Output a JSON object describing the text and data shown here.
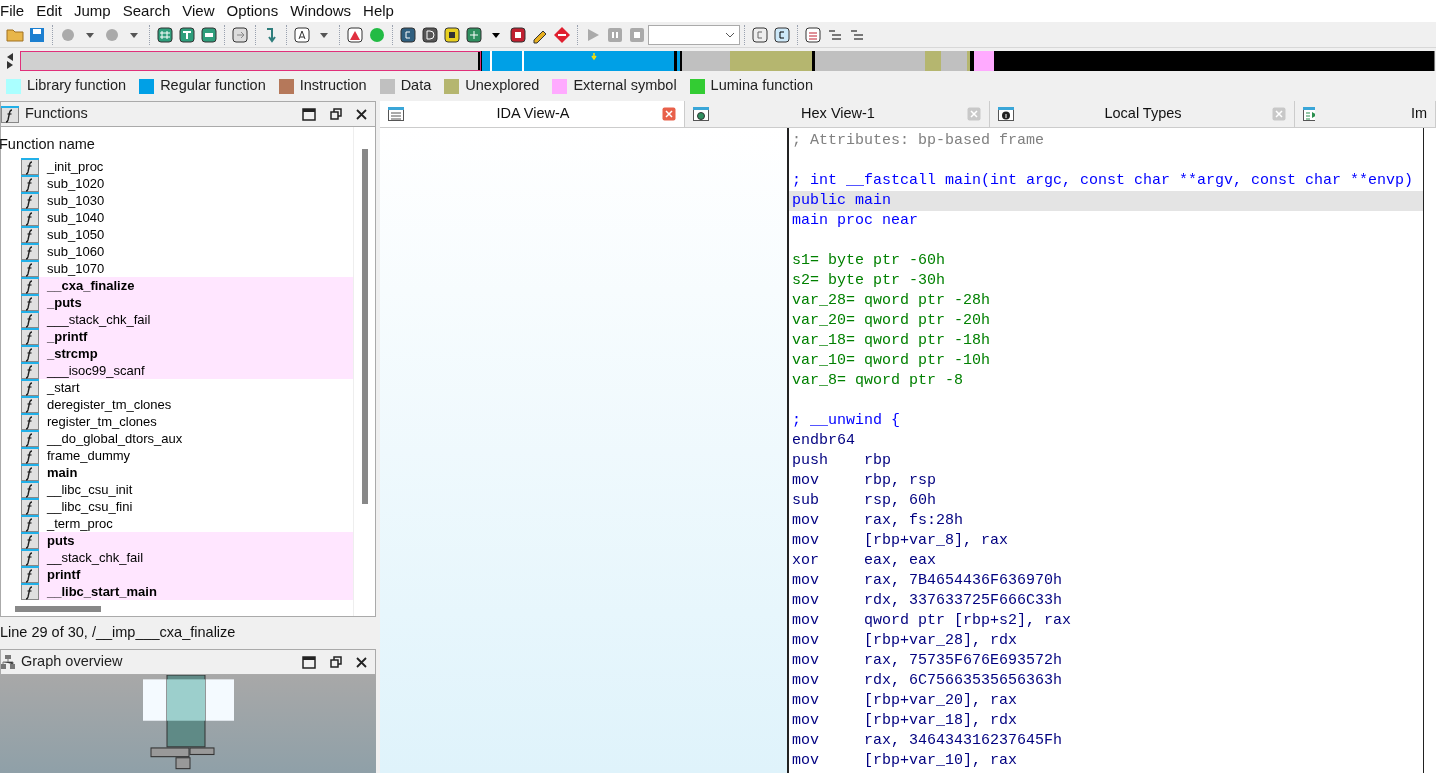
{
  "menu": [
    "File",
    "Edit",
    "Jump",
    "Search",
    "View",
    "Options",
    "Windows",
    "Help"
  ],
  "legend": [
    {
      "label": "Library function",
      "color": "#aaffff"
    },
    {
      "label": "Regular function",
      "color": "#00a0e6"
    },
    {
      "label": "Instruction",
      "color": "#b5785a"
    },
    {
      "label": "Data",
      "color": "#c0c0c0"
    },
    {
      "label": "Unexplored",
      "color": "#b5b66f"
    },
    {
      "label": "External symbol",
      "color": "#ffaaff"
    },
    {
      "label": "Lumina function",
      "color": "#33cc33"
    }
  ],
  "functions_panel": {
    "title": "Functions",
    "column": "Function name",
    "status": "Line 29 of 30, /__imp___cxa_finalize",
    "items": [
      {
        "name": "_init_proc",
        "kind": "regular",
        "bold": false
      },
      {
        "name": "sub_1020",
        "kind": "regular",
        "bold": false
      },
      {
        "name": "sub_1030",
        "kind": "regular",
        "bold": false
      },
      {
        "name": "sub_1040",
        "kind": "regular",
        "bold": false
      },
      {
        "name": "sub_1050",
        "kind": "regular",
        "bold": false
      },
      {
        "name": "sub_1060",
        "kind": "regular",
        "bold": false
      },
      {
        "name": "sub_1070",
        "kind": "regular",
        "bold": false
      },
      {
        "name": "__cxa_finalize",
        "kind": "extern",
        "bold": true
      },
      {
        "name": "_puts",
        "kind": "extern",
        "bold": true
      },
      {
        "name": "___stack_chk_fail",
        "kind": "extern",
        "bold": false
      },
      {
        "name": "_printf",
        "kind": "extern",
        "bold": true
      },
      {
        "name": "_strcmp",
        "kind": "extern",
        "bold": true
      },
      {
        "name": "___isoc99_scanf",
        "kind": "extern",
        "bold": false
      },
      {
        "name": "_start",
        "kind": "regular",
        "bold": false
      },
      {
        "name": "deregister_tm_clones",
        "kind": "regular",
        "bold": false
      },
      {
        "name": "register_tm_clones",
        "kind": "regular",
        "bold": false
      },
      {
        "name": "__do_global_dtors_aux",
        "kind": "regular",
        "bold": false
      },
      {
        "name": "frame_dummy",
        "kind": "regular",
        "bold": false
      },
      {
        "name": "main",
        "kind": "regular",
        "bold": true
      },
      {
        "name": "__libc_csu_init",
        "kind": "regular",
        "bold": false
      },
      {
        "name": "__libc_csu_fini",
        "kind": "regular",
        "bold": false
      },
      {
        "name": "_term_proc",
        "kind": "regular",
        "bold": false
      },
      {
        "name": "puts",
        "kind": "extern",
        "bold": true
      },
      {
        "name": "__stack_chk_fail",
        "kind": "extern",
        "bold": false
      },
      {
        "name": "printf",
        "kind": "extern",
        "bold": true
      },
      {
        "name": "__libc_start_main",
        "kind": "extern",
        "bold": true
      }
    ]
  },
  "graph_overview": {
    "title": "Graph overview"
  },
  "tabs": [
    {
      "label": "IDA View-A",
      "selected": true,
      "kind": "list"
    },
    {
      "label": "Hex View-1",
      "selected": false,
      "kind": "hex"
    },
    {
      "label": "Local Types",
      "selected": false,
      "kind": "info"
    },
    {
      "label": "Im",
      "selected": false,
      "kind": "table"
    }
  ],
  "code": [
    {
      "kind": "comment",
      "text": "; Attributes: bp-based frame",
      "selected": false
    },
    {
      "kind": "blank",
      "selected": false
    },
    {
      "kind": "proto",
      "text": "; int __fastcall main(int argc, const char **argv, const char **envp)",
      "selected": false
    },
    {
      "kind": "label",
      "text": "public main",
      "selected": true
    },
    {
      "kind": "label",
      "text": "main proc near",
      "selected": false
    },
    {
      "kind": "blank",
      "selected": false
    },
    {
      "kind": "var",
      "text": "s1= byte ptr -60h",
      "selected": false
    },
    {
      "kind": "var",
      "text": "s2= byte ptr -30h",
      "selected": false
    },
    {
      "kind": "var",
      "text": "var_28= qword ptr -28h",
      "selected": false
    },
    {
      "kind": "var",
      "text": "var_20= qword ptr -20h",
      "selected": false
    },
    {
      "kind": "var",
      "text": "var_18= qword ptr -18h",
      "selected": false
    },
    {
      "kind": "var",
      "text": "var_10= qword ptr -10h",
      "selected": false
    },
    {
      "kind": "var",
      "text": "var_8= qword ptr -8",
      "selected": false
    },
    {
      "kind": "blank",
      "selected": false
    },
    {
      "kind": "proto",
      "text": "; __unwind {",
      "selected": false
    },
    {
      "kind": "instr",
      "mnemonic": "endbr64",
      "selected": false
    },
    {
      "kind": "instr",
      "mnemonic": "push",
      "operands": "rbp",
      "selected": false
    },
    {
      "kind": "instr",
      "mnemonic": "mov",
      "operands": "rbp, rsp",
      "selected": false
    },
    {
      "kind": "instr",
      "mnemonic": "sub",
      "operands": "rsp, 60h",
      "selected": false
    },
    {
      "kind": "instr",
      "mnemonic": "mov",
      "operands": "rax, fs:28h",
      "selected": false
    },
    {
      "kind": "instr",
      "mnemonic": "mov",
      "operands": "[rbp+var_8], rax",
      "selected": false
    },
    {
      "kind": "instr",
      "mnemonic": "xor",
      "operands": "eax, eax",
      "selected": false
    },
    {
      "kind": "instr",
      "mnemonic": "mov",
      "operands": "rax, 7B4654436F636970h",
      "selected": false
    },
    {
      "kind": "instr",
      "mnemonic": "mov",
      "operands": "rdx, 337633725F666C33h",
      "selected": false
    },
    {
      "kind": "instr",
      "mnemonic": "mov",
      "operands": "qword ptr [rbp+s2], rax",
      "selected": false
    },
    {
      "kind": "instr",
      "mnemonic": "mov",
      "operands": "[rbp+var_28], rdx",
      "selected": false
    },
    {
      "kind": "instr",
      "mnemonic": "mov",
      "operands": "rax, 75735F676E693572h",
      "selected": false
    },
    {
      "kind": "instr",
      "mnemonic": "mov",
      "operands": "rdx, 6C75663535656363h",
      "selected": false
    },
    {
      "kind": "instr",
      "mnemonic": "mov",
      "operands": "[rbp+var_20], rax",
      "selected": false
    },
    {
      "kind": "instr",
      "mnemonic": "mov",
      "operands": "[rbp+var_18], rdx",
      "selected": false
    },
    {
      "kind": "instr",
      "mnemonic": "mov",
      "operands": "rax, 346434316237645Fh",
      "selected": false
    },
    {
      "kind": "instr",
      "mnemonic": "mov",
      "operands": "[rbp+var_10], rax",
      "selected": false
    }
  ]
}
